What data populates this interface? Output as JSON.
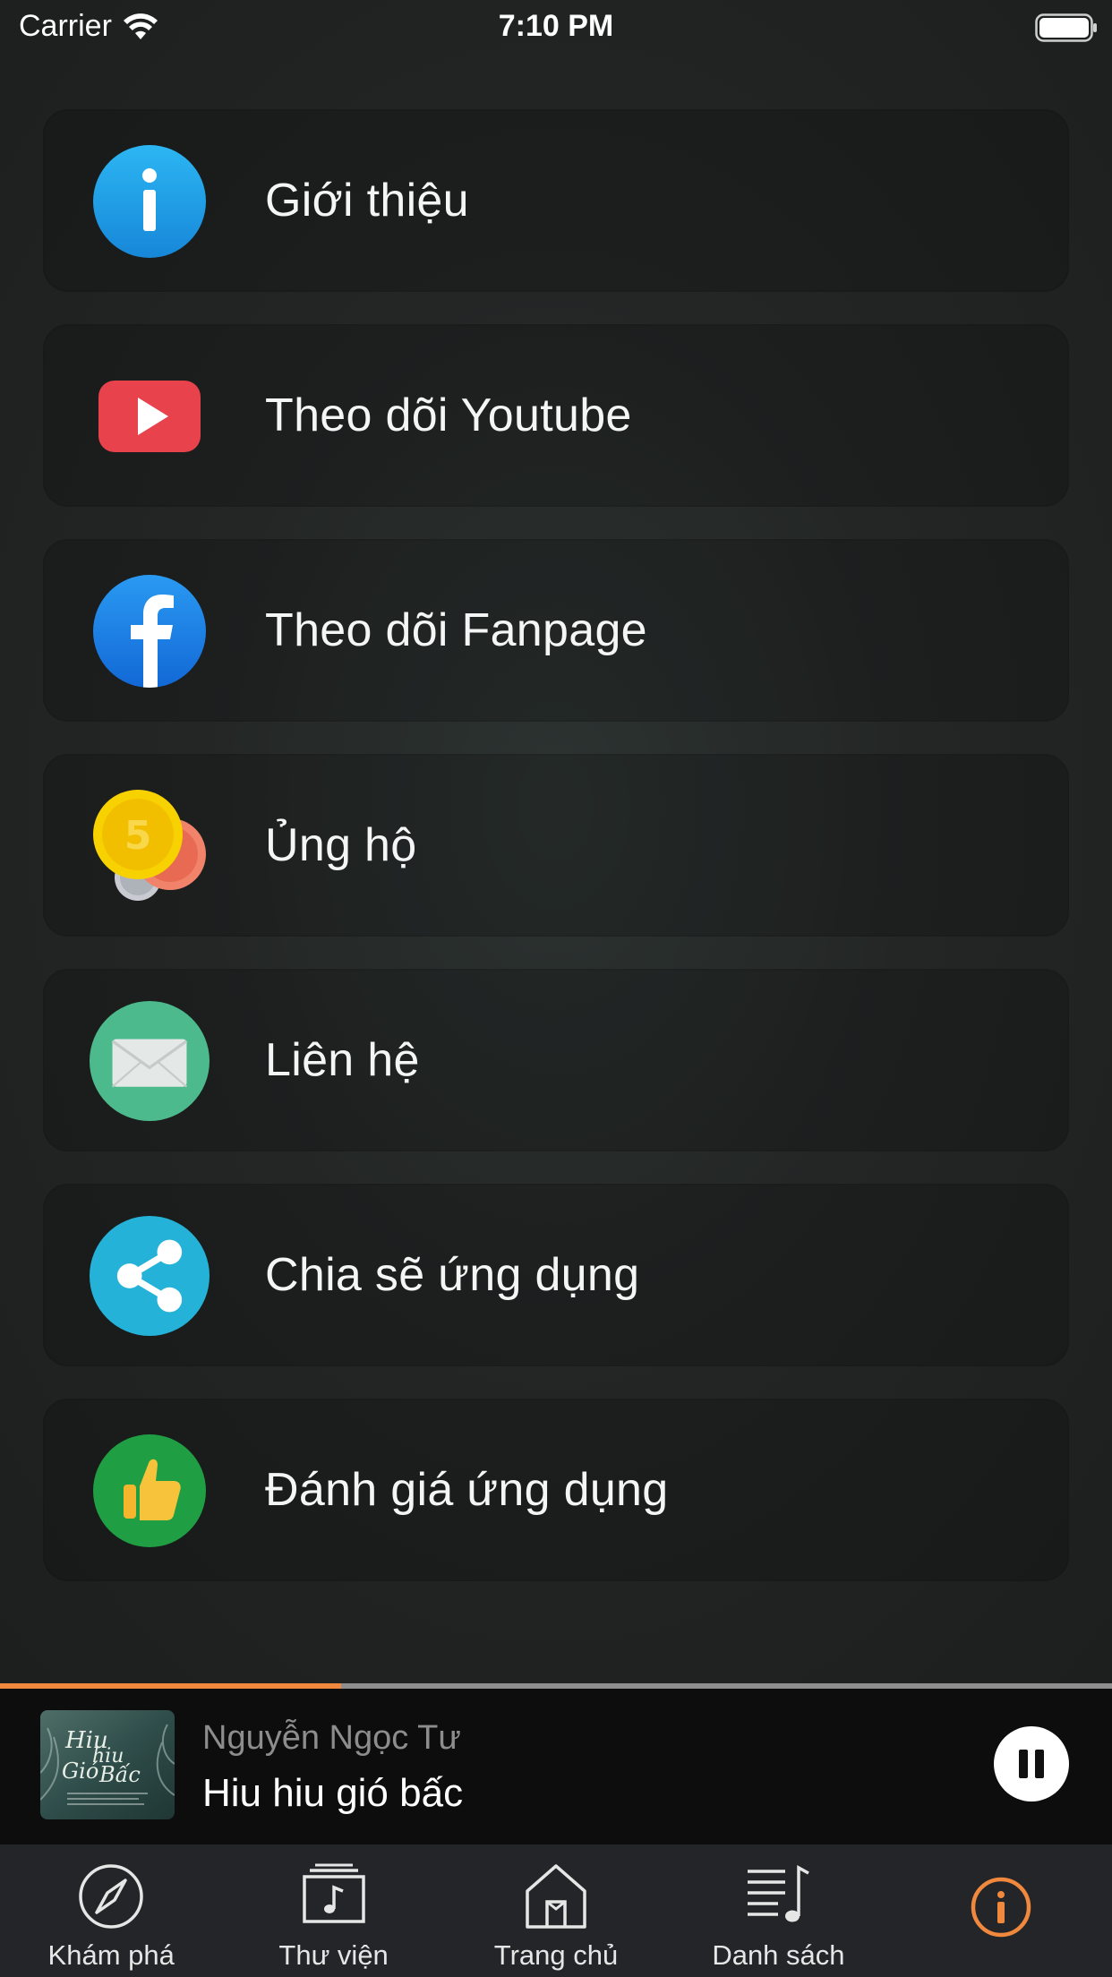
{
  "status_bar": {
    "carrier": "Carrier",
    "time": "7:10 PM"
  },
  "menu": {
    "items": [
      {
        "label": "Giới thiệu",
        "icon": "info-icon",
        "color": "#1e9be8"
      },
      {
        "label": "Theo dõi Youtube",
        "icon": "youtube-icon",
        "color": "#e8424c"
      },
      {
        "label": "Theo dõi Fanpage",
        "icon": "facebook-icon",
        "color": "#1b7fe6"
      },
      {
        "label": "Ủng hộ",
        "icon": "coins-icon",
        "color": "#f5c400"
      },
      {
        "label": "Liên hệ",
        "icon": "mail-icon",
        "color": "#4cba8c"
      },
      {
        "label": "Chia sẽ ứng dụng",
        "icon": "share-icon",
        "color": "#24b2d8"
      },
      {
        "label": "Đánh giá ứng dụng",
        "icon": "thumbs-up-icon",
        "color": "#1f9e44"
      }
    ]
  },
  "player": {
    "artist": "Nguyễn Ngọc Tư",
    "title": "Hiu hiu gió bấc",
    "progress": 0.307,
    "progress_color": "#f0883e",
    "state": "playing"
  },
  "tab_bar": {
    "tabs": [
      {
        "label": "Khám phá",
        "icon": "compass-icon",
        "active": false
      },
      {
        "label": "Thư viện",
        "icon": "music-library-icon",
        "active": false
      },
      {
        "label": "Trang chủ",
        "icon": "home-icon",
        "active": false
      },
      {
        "label": "Danh sách",
        "icon": "playlist-icon",
        "active": false
      },
      {
        "label": "",
        "icon": "info-icon",
        "active": true
      }
    ],
    "active_color": "#f0883e"
  }
}
